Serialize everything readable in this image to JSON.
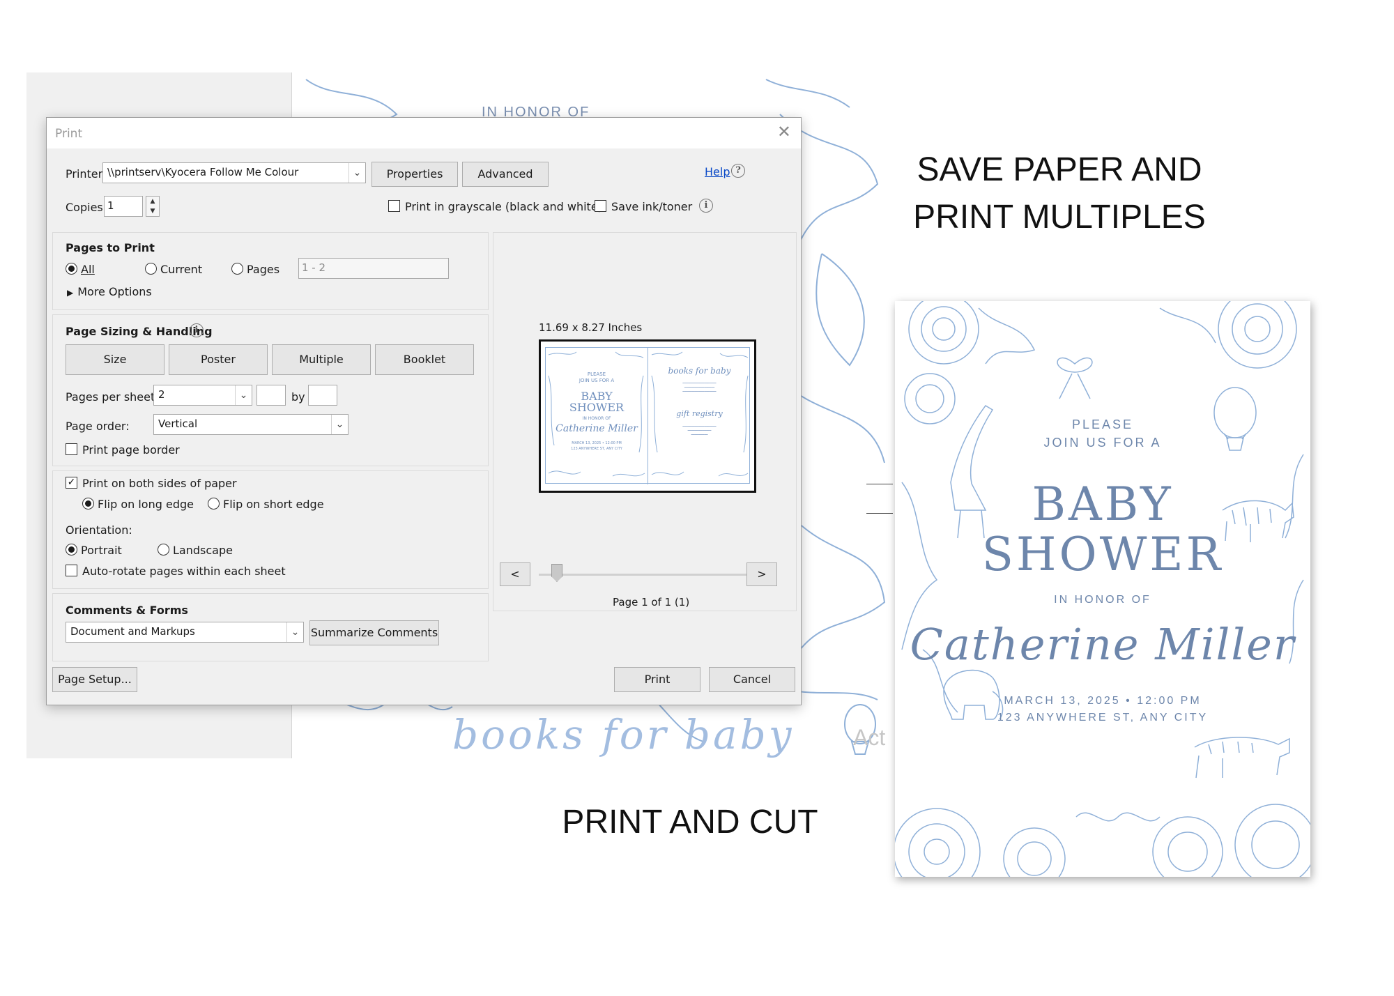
{
  "background": {
    "in_honor_of": "IN HONOR OF",
    "books_for_baby": "books for baby",
    "act_watermark": "Act"
  },
  "dialog": {
    "title": "Print",
    "close_icon": "close-icon",
    "printer_label": "Printer:",
    "printer_value": "\\\\printserv\\Kyocera Follow Me Colour",
    "properties_label": "Properties",
    "advanced_label": "Advanced",
    "help_label": "Help",
    "copies_label": "Copies:",
    "copies_value": "1",
    "grayscale_label": "Print in grayscale (black and white)",
    "save_ink_label": "Save ink/toner",
    "pages_to_print": {
      "title": "Pages to Print",
      "all_label": "All",
      "current_label": "Current",
      "pages_label": "Pages",
      "pages_value": "1 - 2",
      "more_options_label": "More Options"
    },
    "page_sizing": {
      "title": "Page Sizing & Handling",
      "size_label": "Size",
      "poster_label": "Poster",
      "multiple_label": "Multiple",
      "booklet_label": "Booklet",
      "pages_per_sheet_label": "Pages per sheet:",
      "pages_per_sheet_value": "2",
      "by_label": "by",
      "page_order_label": "Page order:",
      "page_order_value": "Vertical",
      "print_border_label": "Print page border"
    },
    "duplex": {
      "both_sides_label": "Print on both sides of paper",
      "flip_long_label": "Flip on long edge",
      "flip_short_label": "Flip on short edge",
      "orientation_label": "Orientation:",
      "portrait_label": "Portrait",
      "landscape_label": "Landscape",
      "auto_rotate_label": "Auto-rotate pages within each sheet"
    },
    "comments": {
      "title": "Comments & Forms",
      "value": "Document and Markups",
      "summarize_label": "Summarize Comments"
    },
    "preview": {
      "size_label": "11.69 x 8.27 Inches",
      "page_label": "Page 1 of 1 (1)",
      "prev_label": "<",
      "next_label": ">",
      "mini_left": [
        "PLEASE",
        "JOIN US FOR A",
        "BABY",
        "SHOWER",
        "IN HONOR OF",
        "Catherine Miller",
        "MARCH 13, 2025 • 12:00 PM",
        "123 ANYWHERE ST, ANY CITY"
      ],
      "mini_right": [
        "books for baby",
        "gift registry"
      ]
    },
    "page_setup_label": "Page Setup...",
    "print_label": "Print",
    "cancel_label": "Cancel"
  },
  "marketing": {
    "headline_line1": "SAVE PAPER AND",
    "headline_line2": "PRINT MULTIPLES",
    "print_and_cut": "PRINT AND CUT"
  },
  "card": {
    "please": "PLEASE",
    "join": "JOIN US FOR A",
    "baby": "BABY",
    "shower": "SHOWER",
    "in_honor_of": "IN HONOR OF",
    "name": "Catherine Miller",
    "date": "MARCH 13, 2025 • 12:00 PM",
    "address": "123 ANYWHERE ST, ANY CITY",
    "accent_color": "#6d86ab"
  }
}
